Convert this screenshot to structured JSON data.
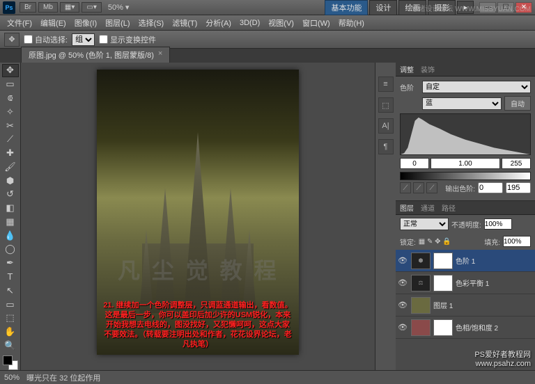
{
  "appbar": {
    "br": "Br",
    "mb": "Mb",
    "zoom": "50% ▾",
    "workspaces": [
      "基本功能",
      "设计",
      "绘画",
      "摄影"
    ],
    "extra": "▸"
  },
  "menu": [
    "文件(F)",
    "编辑(E)",
    "图像(I)",
    "图层(L)",
    "选择(S)",
    "滤镜(T)",
    "分析(A)",
    "3D(D)",
    "视图(V)",
    "窗口(W)",
    "帮助(H)"
  ],
  "options": {
    "autoselect": "自动选择:",
    "group": "组",
    "transform": "显示变换控件"
  },
  "tab": {
    "title": "原图.jpg @ 50% (色阶 1, 图层蒙版/8)",
    "close": "×"
  },
  "canvas": {
    "line1": "21. 继续加一个色阶调整层，只调蓝通道输出，看数值。",
    "line2": "这是最后一步，你可以盖印后加少许的USM锐化，本来",
    "line3": "开始我想去电线的，图没找好，又犯懒呵呵，这点大家",
    "line4": "不要效法。（转载要注明出处和作者，花花设界论坛，老凡执笔）",
    "wm": "凡 尘 觉 教 程"
  },
  "adjustments": {
    "tabs": [
      "调整",
      "装饰"
    ],
    "label": "色阶",
    "preset": "自定",
    "channel": "蓝",
    "auto": "自动",
    "in_black": "0",
    "in_mid": "1.00",
    "in_white": "255",
    "out_label": "输出色阶:",
    "out_black": "0",
    "out_white": "195"
  },
  "layers": {
    "tabs": [
      "图层",
      "通道",
      "路径"
    ],
    "blend": "正常",
    "opacity_lbl": "不透明度:",
    "opacity": "100%",
    "lock_lbl": "锁定:",
    "fill_lbl": "填充:",
    "fill": "100%",
    "items": [
      {
        "name": "色阶 1",
        "sel": true
      },
      {
        "name": "色彩平衡 1",
        "sel": false
      },
      {
        "name": "图层 1",
        "sel": false
      },
      {
        "name": "色相/饱和度 2",
        "sel": false
      }
    ]
  },
  "status": {
    "zoom": "50%",
    "info": "曝光只在 32 位起作用"
  },
  "watermark": {
    "top": "思绪设计论坛  WWW.MISSYUAN.COM",
    "bottom1": "PS爱好者教程网",
    "bottom2": "www.psahz.com"
  }
}
